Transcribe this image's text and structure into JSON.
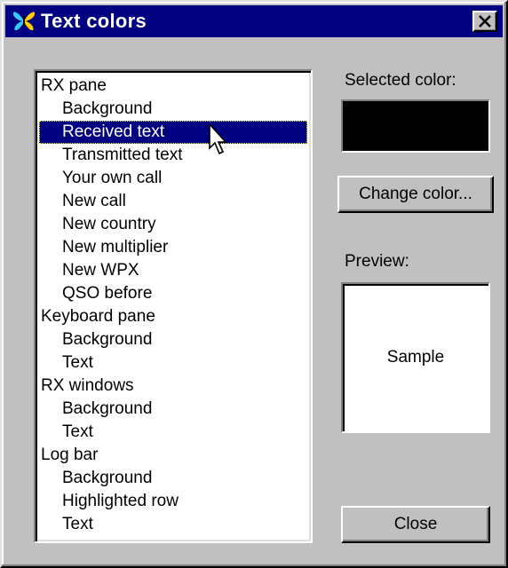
{
  "window": {
    "title": "Text colors",
    "title_bar_color": "#000080",
    "close_icon": "close-x-icon",
    "app_icon": "butterfly-icon"
  },
  "color_list": {
    "selected_index": 2,
    "items": [
      {
        "label": "RX pane",
        "level": 0
      },
      {
        "label": "Background",
        "level": 1
      },
      {
        "label": "Received text",
        "level": 1
      },
      {
        "label": "Transmitted text",
        "level": 1
      },
      {
        "label": "Your own call",
        "level": 1
      },
      {
        "label": "New call",
        "level": 1
      },
      {
        "label": "New country",
        "level": 1
      },
      {
        "label": "New multiplier",
        "level": 1
      },
      {
        "label": "New WPX",
        "level": 1
      },
      {
        "label": "QSO before",
        "level": 1
      },
      {
        "label": "Keyboard pane",
        "level": 0
      },
      {
        "label": "Background",
        "level": 1
      },
      {
        "label": "Text",
        "level": 1
      },
      {
        "label": "RX windows",
        "level": 0
      },
      {
        "label": "Background",
        "level": 1
      },
      {
        "label": "Text",
        "level": 1
      },
      {
        "label": "Log bar",
        "level": 0
      },
      {
        "label": "Background",
        "level": 1
      },
      {
        "label": "Highlighted row",
        "level": 1
      },
      {
        "label": "Text",
        "level": 1
      }
    ]
  },
  "selected_color": {
    "label": "Selected color:",
    "value": "#000000"
  },
  "buttons": {
    "change_color": "Change color...",
    "close": "Close"
  },
  "preview": {
    "label": "Preview:",
    "sample_text": "Sample",
    "background": "#ffffff"
  }
}
